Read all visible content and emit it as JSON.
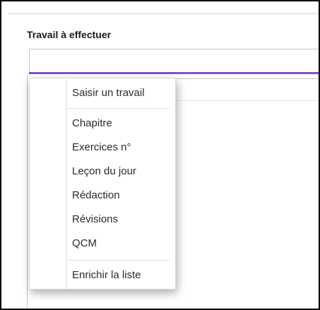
{
  "section": {
    "title": "Travail à effectuer"
  },
  "work_input": {
    "value": ""
  },
  "menu": {
    "header_item": "Saisir un travail",
    "items": [
      "Chapitre",
      "Exercices n°",
      "Leçon du jour",
      "Rédaction",
      "Révisions",
      "QCM"
    ],
    "footer_item": "Enrichir la liste"
  },
  "colors": {
    "accent": "#8a4fc3",
    "text": "#2b2b2b",
    "border": "#c4c4c4"
  }
}
